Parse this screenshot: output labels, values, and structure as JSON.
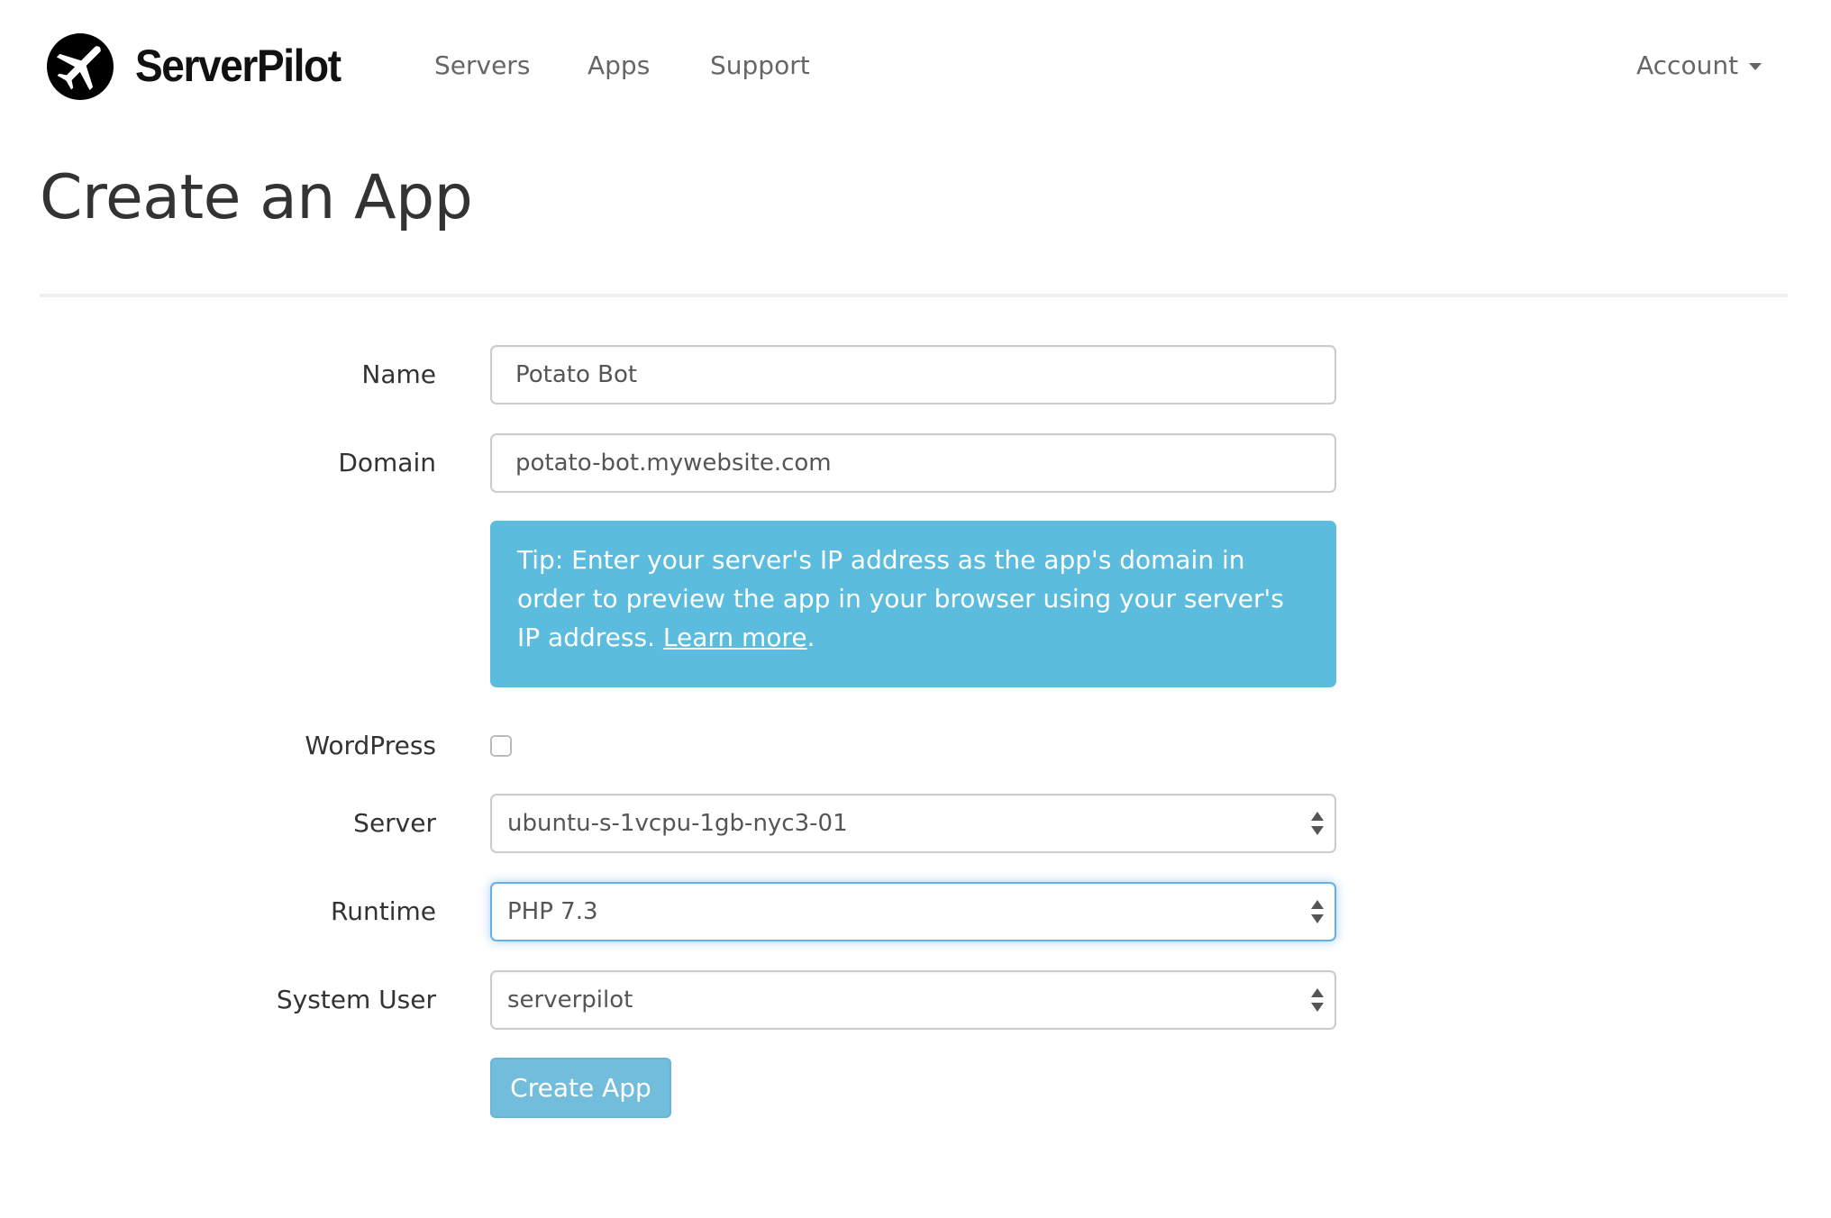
{
  "header": {
    "brand": "ServerPilot",
    "logo_icon": "airplane-circle-icon",
    "nav": [
      {
        "label": "Servers"
      },
      {
        "label": "Apps"
      },
      {
        "label": "Support"
      }
    ],
    "account": {
      "label": "Account",
      "icon": "caret-down-icon"
    }
  },
  "page": {
    "title": "Create an App"
  },
  "form": {
    "name": {
      "label": "Name",
      "value": "Potato Bot"
    },
    "domain": {
      "label": "Domain",
      "value": "potato-bot.mywebsite.com"
    },
    "tip": {
      "text": "Tip: Enter your server's IP address as the app's domain in order to preview the app in your browser using your server's IP address. ",
      "link_label": "Learn more",
      "suffix": ".",
      "background_color": "#5bbcdd"
    },
    "wordpress": {
      "label": "WordPress",
      "checked": false
    },
    "server": {
      "label": "Server",
      "value": "ubuntu-s-1vcpu-1gb-nyc3-01"
    },
    "runtime": {
      "label": "Runtime",
      "value": "PHP 7.3",
      "focused": true
    },
    "system_user": {
      "label": "System User",
      "value": "serverpilot"
    },
    "submit_label": "Create App"
  },
  "colors": {
    "accent": "#5bbcdd",
    "button": "#73bddc",
    "focus_border": "#66afe9",
    "nav_text": "#666666",
    "divider": "#eeeeee"
  }
}
